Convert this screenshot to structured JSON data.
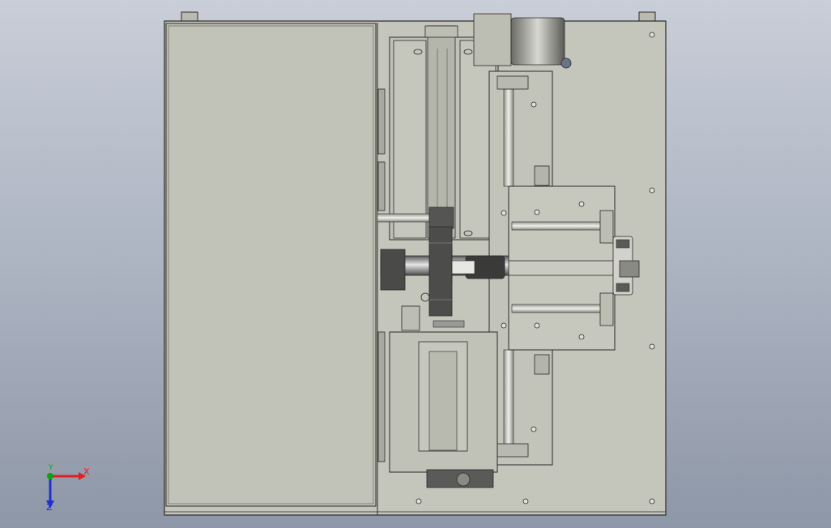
{
  "viewport": {
    "background_top": "#c9ced8",
    "background_bottom": "#8e97a7"
  },
  "model": {
    "plate_color": "#c4c5bb",
    "line_color": "#2a2a2a",
    "dark_part_color": "#3c3c3c"
  },
  "triad": {
    "x_label": "X",
    "y_label": "Y",
    "z_label": "Z",
    "x_color": "#e02020",
    "y_color": "#10a010",
    "z_color": "#2030d0"
  }
}
